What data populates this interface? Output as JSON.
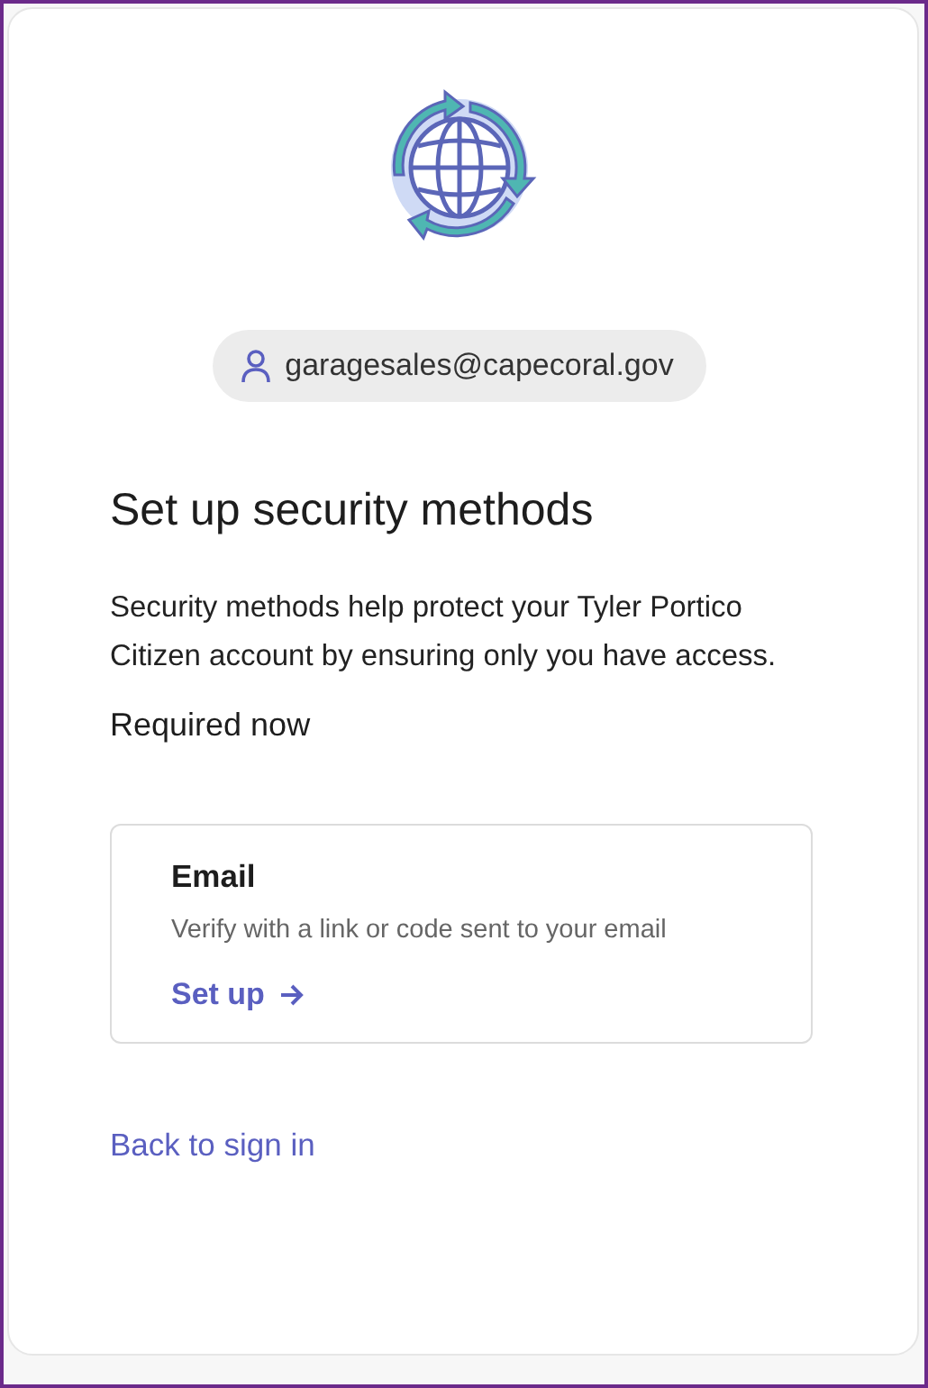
{
  "account": {
    "email": "garagesales@capecoral.gov"
  },
  "heading": "Set up security methods",
  "description": "Security methods help protect your Tyler Portico Citizen account by ensuring only you have access.",
  "section_label": "Required now",
  "methods": [
    {
      "title": "Email",
      "description": "Verify with a link or code sent to your email",
      "action": "Set up"
    }
  ],
  "back_link": "Back to sign in"
}
